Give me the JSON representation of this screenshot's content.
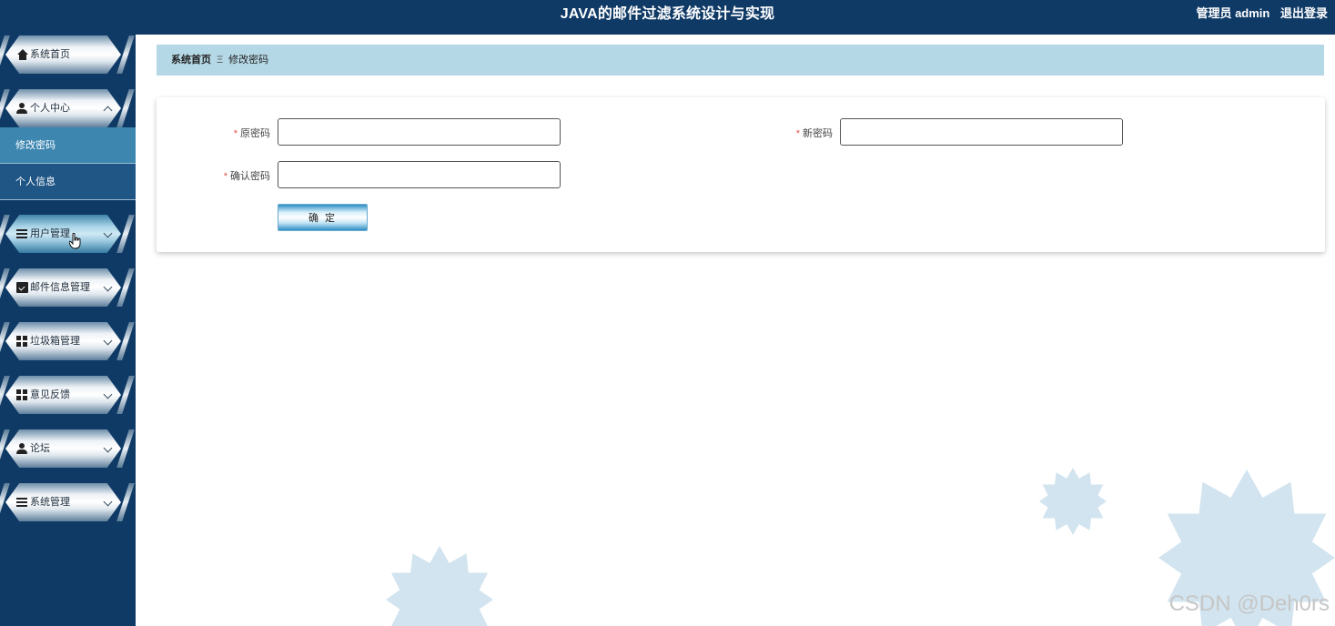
{
  "header": {
    "title": "JAVA的邮件过滤系统设计与实现",
    "user_label": "管理员 admin",
    "logout_label": "退出登录"
  },
  "sidebar": {
    "items": [
      {
        "label": "系统首页",
        "icon": "home-icon"
      },
      {
        "label": "个人中心",
        "icon": "user-icon",
        "expanded": true,
        "children": [
          {
            "label": "修改密码",
            "active": true
          },
          {
            "label": "个人信息",
            "active": false
          }
        ]
      },
      {
        "label": "用户管理",
        "icon": "list-icon"
      },
      {
        "label": "邮件信息管理",
        "icon": "clipboard-icon"
      },
      {
        "label": "垃圾箱管理",
        "icon": "grid-icon"
      },
      {
        "label": "意见反馈",
        "icon": "grid-icon"
      },
      {
        "label": "论坛",
        "icon": "user-icon"
      },
      {
        "label": "系统管理",
        "icon": "list-icon"
      }
    ]
  },
  "breadcrumb": {
    "home": "系统首页",
    "separator": "Ξ",
    "current": "修改密码"
  },
  "form": {
    "required_mark": "*",
    "old_password": {
      "label": "原密码",
      "value": "",
      "placeholder": ""
    },
    "new_password": {
      "label": "新密码",
      "value": "",
      "placeholder": ""
    },
    "confirm_password": {
      "label": "确认密码",
      "value": "",
      "placeholder": ""
    },
    "submit_label": "确 定"
  },
  "watermark": "CSDN @Deh0rs",
  "colors": {
    "header_bg": "#0f3a66",
    "sidebar_bg": "#0f3a66",
    "submenu_active": "#3c86b0",
    "breadcrumb_bg": "#b5d8e6",
    "required": "#e0554c"
  }
}
